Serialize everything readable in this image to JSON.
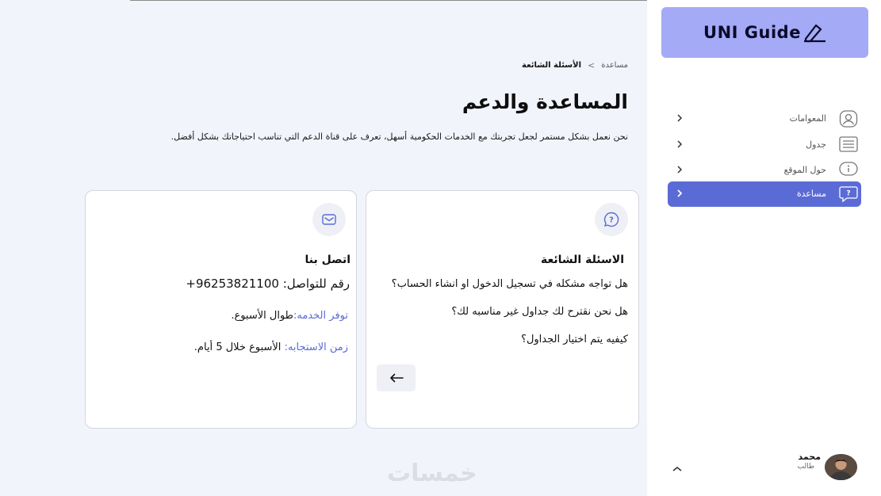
{
  "breadcrumb": {
    "home": "مساعدة",
    "current": "الأسئلة الشائعة",
    "separator": ">"
  },
  "page": {
    "title": "المساعدة والدعم",
    "subtitle": "نحن نعمل بشكل مستمر لجعل تجربتك مع الخدمات الحكومية أسهل، تعرف على قناة الدعم التي تناسب احتياجاتك بشكل أفضل."
  },
  "faq_card": {
    "icon": "help-chat-icon",
    "title": "الاسئلة الشائعة",
    "questions": [
      "هل تواجه مشكله في تسجيل الدخول او انشاء الحساب؟",
      "هل نحن نقترح لك جداول غير مناسبه لك؟",
      "كيفيه يتم اختيار الجداول؟"
    ],
    "button_icon": "arrow-left-icon"
  },
  "contact_card": {
    "icon": "mail-icon",
    "title": "اتصل بنا",
    "phone_label": "رقم للتواصل:",
    "phone": "96253821100+",
    "availability_label": "توفر الخدمه:",
    "availability_value": "طوال الأسبوع.",
    "response_label": "زمن الاستجابه:",
    "response_value": "الأسبوع خلال 5  أيام."
  },
  "watermark": "خمسات",
  "sidebar": {
    "logo_text": "UNI Guide",
    "items": [
      {
        "label": "المعوامات",
        "icon": "user-icon"
      },
      {
        "label": "جدول",
        "icon": "list-icon"
      },
      {
        "label": "حول الموقع",
        "icon": "info-icon"
      },
      {
        "label": "مساعدة",
        "icon": "help-chat-icon",
        "active": true
      }
    ],
    "user": {
      "name": "محمد",
      "role": "طالب"
    }
  },
  "colors": {
    "accent": "#5b6bd6",
    "logo_bg": "#a4aaf6",
    "page_bg": "#f2f4fc"
  }
}
